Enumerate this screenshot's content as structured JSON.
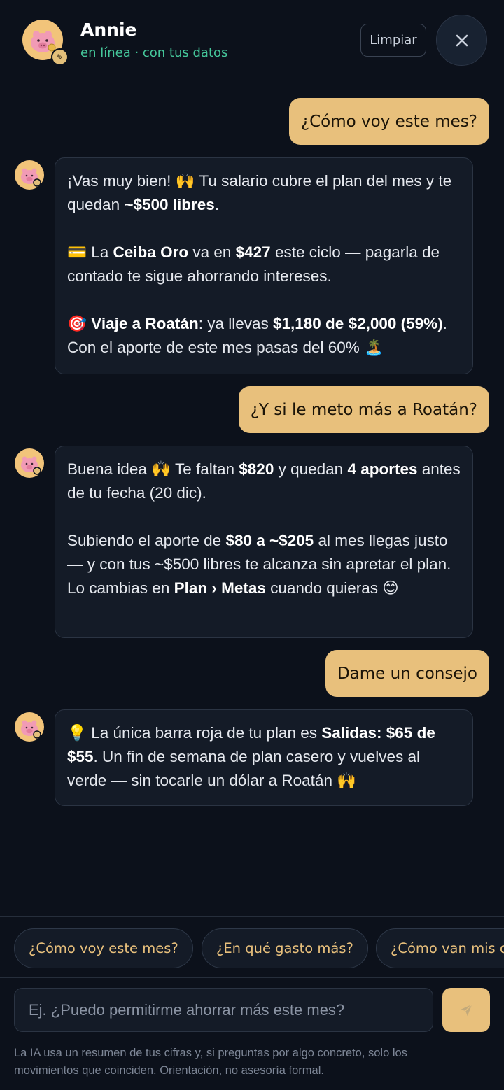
{
  "header": {
    "name": "Annie",
    "status": "en línea · con tus datos",
    "clear_label": "Limpiar",
    "avatar_icon": "piggy-bank-icon",
    "edit_icon": "pencil-icon",
    "close_icon": "close-icon"
  },
  "messages": [
    {
      "role": "user",
      "text": "¿Cómo voy este mes?"
    },
    {
      "role": "assistant",
      "p1": {
        "a": "¡Vas muy bien! 🙌 Tu salario cubre el plan del mes y te quedan ",
        "b": "~$500 libres",
        "c": "."
      },
      "p2": {
        "a": "💳 La ",
        "b": "Ceiba Oro",
        "c": " va en ",
        "d": "$427",
        "e": " este ciclo — pagarla de contado te sigue ahorrando intereses."
      },
      "p3": {
        "a": "🎯 ",
        "b": "Viaje a Roatán",
        "c": ": ya llevas ",
        "d": "$1,180 de $2,000 (59%)",
        "e": ". Con el aporte de este mes pasas del 60% 🏝️"
      }
    },
    {
      "role": "user",
      "text": "¿Y si le meto más a Roatán?"
    },
    {
      "role": "assistant",
      "p1": {
        "a": "Buena idea 🙌 Te faltan ",
        "b": "$820",
        "c": " y quedan ",
        "d": "4 aportes",
        "e": " antes de tu fecha (20 dic)."
      },
      "p2": {
        "a": "Subiendo el aporte de ",
        "b": "$80 a ~$205",
        "c": " al mes llegas justo — y con tus ~$500 libres te alcanza sin apretar el plan. Lo cambias en ",
        "d": "Plan › Metas",
        "e": " cuando quieras 😊"
      }
    },
    {
      "role": "user",
      "text": "Dame un consejo"
    },
    {
      "role": "assistant",
      "p1": {
        "a": "💡 La única barra roja de tu plan es ",
        "b": "Salidas: $65 de $55",
        "c": ". Un fin de semana de plan casero y vuelves al verde — sin tocarle un dólar a Roatán 🙌"
      }
    }
  ],
  "suggestions": [
    "¿Cómo voy este mes?",
    "¿En qué gasto más?",
    "¿Cómo van mis d"
  ],
  "composer": {
    "placeholder": "Ej. ¿Puedo permitirme ahorrar más este mes?",
    "send_icon": "send-icon"
  },
  "disclaimer": "La IA usa un resumen de tus cifras y, si preguntas por algo concreto, solo los movimientos que coinciden. Orientación, no asesoría formal.",
  "colors": {
    "background": "#0c111b",
    "accent": "#e8c07c",
    "online": "#45c69a",
    "bubble_bot": "#141b27"
  }
}
